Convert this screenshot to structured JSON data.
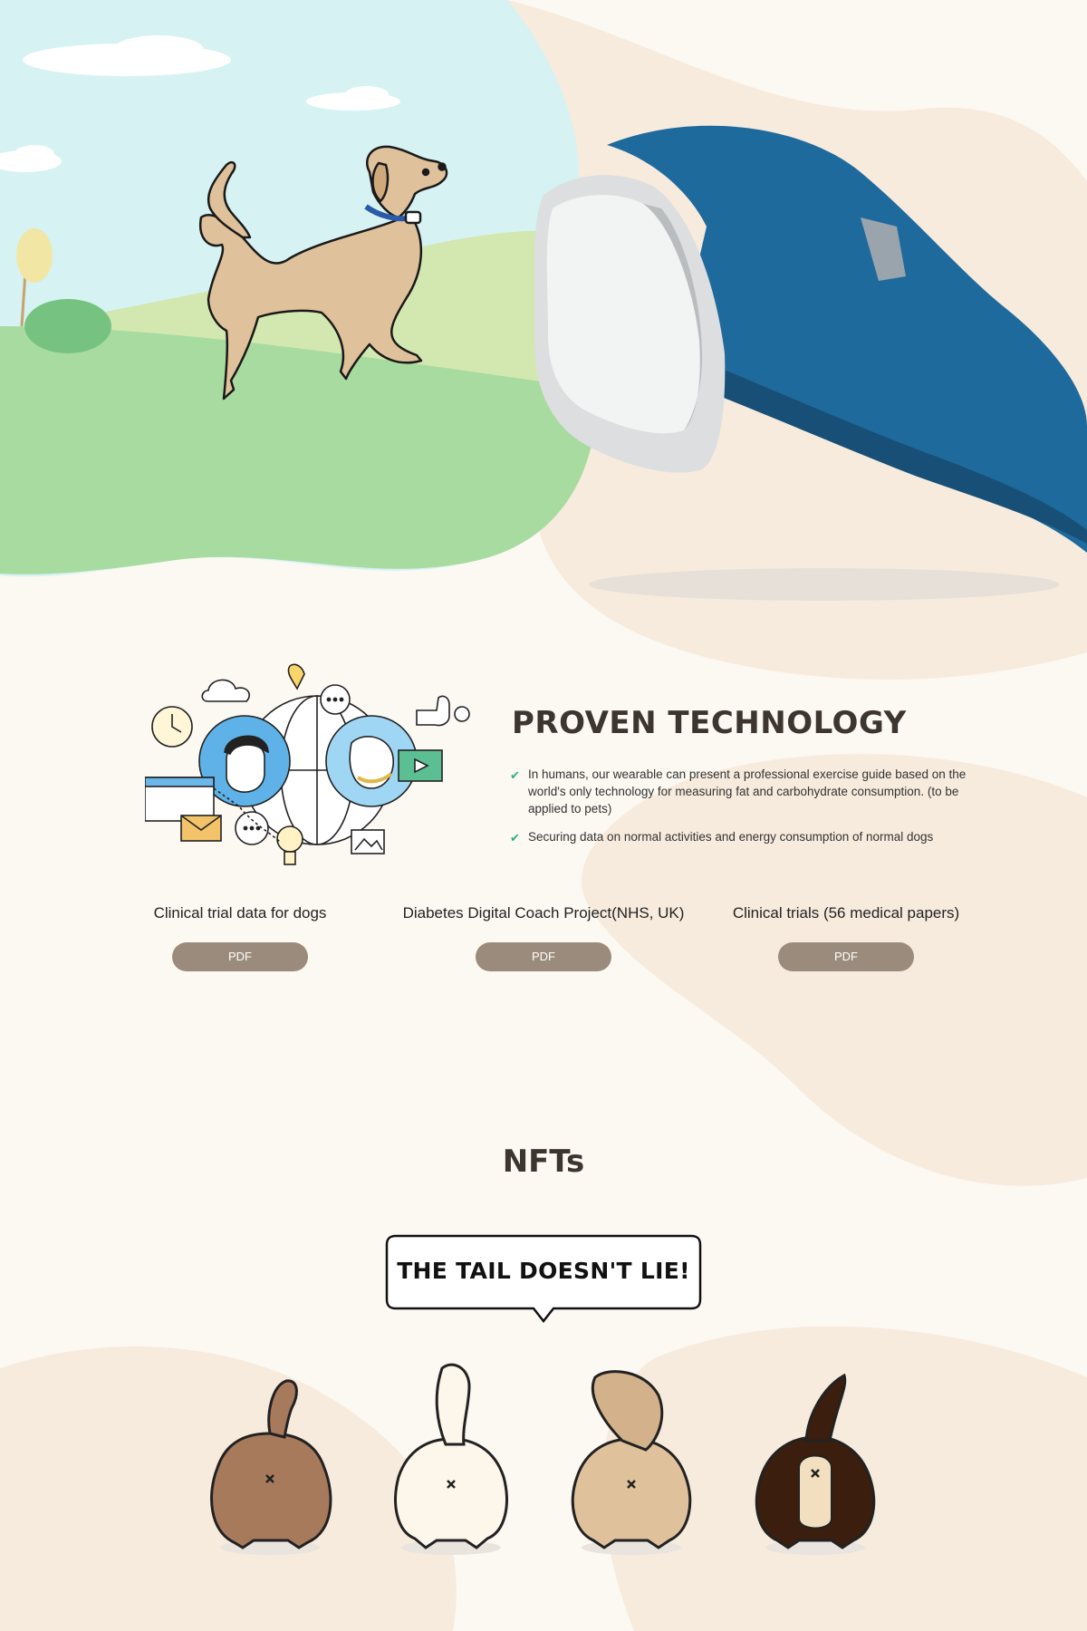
{
  "colors": {
    "page_background": "#fcf8f2",
    "sky": "#d6f2f3",
    "hill_light": "#d3e8b0",
    "hill_green": "#a8dba0",
    "golden_dog": "#dfc19b",
    "band_blue": "#1f6a9c",
    "pdf_button": "#9b8b7c",
    "check_green": "#2ab37a",
    "heading": "#3d3530"
  },
  "hero": {
    "illustration": "walking-golden-retriever-illustration",
    "product": "blue-leather-wristband"
  },
  "technology": {
    "title": "PROVEN TECHNOLOGY",
    "illustration": "connected-technology-illustration",
    "points": [
      {
        "icon": "check-icon",
        "text": "In humans, our wearable can present a professional exercise guide based on the world's only technology for measuring fat and carbohydrate consumption. (to be applied to pets)"
      },
      {
        "icon": "check-icon",
        "text": "Securing data on normal activities and energy consumption of  normal dogs"
      }
    ]
  },
  "documents": [
    {
      "title": "Clinical trial data for dogs",
      "button": "PDF"
    },
    {
      "title": "Diabetes Digital Coach Project(NHS, UK)",
      "button": "PDF"
    },
    {
      "title": "Clinical trials (56 medical papers)",
      "button": "PDF"
    }
  ],
  "nfts": {
    "title": "NFTs",
    "speech": "THE TAIL DOESN'T LIE!",
    "dogs": [
      {
        "name": "brown-curly-dog",
        "color": "#a87a5c"
      },
      {
        "name": "white-dog",
        "color": "#fdf6ea"
      },
      {
        "name": "fluffy-tan-dog",
        "color": "#dfc19b"
      },
      {
        "name": "dark-brown-dog",
        "color": "#3b1e0e"
      }
    ]
  }
}
